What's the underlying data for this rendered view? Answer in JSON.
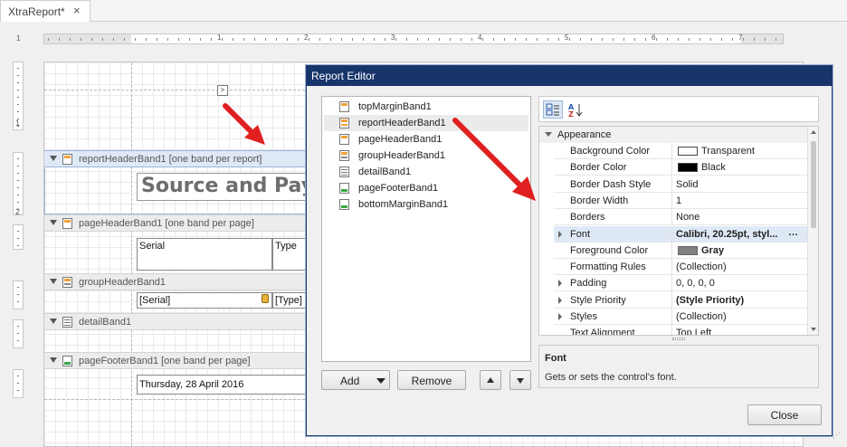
{
  "document_tab": {
    "label": "XtraReport*",
    "close": "×"
  },
  "ruler": {
    "corner_number": "1",
    "numbers": [
      "1",
      "2",
      "3",
      "4",
      "5",
      "6",
      "7"
    ]
  },
  "vruler_marks": [
    "1",
    "2"
  ],
  "designer": {
    "bands": [
      {
        "label": "reportHeaderBand1 [one band per report]",
        "selected": true
      },
      {
        "label": "pageHeaderBand1 [one band per page]"
      },
      {
        "label": "groupHeaderBand1"
      },
      {
        "label": "detailBand1"
      },
      {
        "label": "pageFooterBand1 [one band per page]"
      }
    ],
    "title_text": "Source and Paym",
    "smart_tag": ">",
    "header_cells": [
      "Serial",
      "Type"
    ],
    "group_cells": [
      "[Serial]",
      "[Type]"
    ],
    "footer_date": "Thursday, 28 April 2016"
  },
  "dialog": {
    "title": "Report Editor",
    "band_list": [
      {
        "label": "topMarginBand1",
        "icon": "top-margin-band-icon"
      },
      {
        "label": "reportHeaderBand1",
        "icon": "report-header-band-icon",
        "selected": true
      },
      {
        "label": "pageHeaderBand1",
        "icon": "page-header-band-icon"
      },
      {
        "label": "groupHeaderBand1",
        "icon": "group-header-band-icon"
      },
      {
        "label": "detailBand1",
        "icon": "detail-band-icon"
      },
      {
        "label": "pageFooterBand1",
        "icon": "page-footer-band-icon"
      },
      {
        "label": "bottomMarginBand1",
        "icon": "bottom-margin-band-icon"
      }
    ],
    "buttons": {
      "add": "Add",
      "remove": "Remove",
      "close": "Close"
    },
    "property_grid": {
      "category": "Appearance",
      "properties": [
        {
          "name": "Background Color",
          "value": "Transparent",
          "swatch": "#ffffff"
        },
        {
          "name": "Border Color",
          "value": "Black",
          "swatch": "#000000"
        },
        {
          "name": "Border Dash Style",
          "value": "Solid"
        },
        {
          "name": "Border Width",
          "value": "1"
        },
        {
          "name": "Borders",
          "value": "None"
        },
        {
          "name": "Font",
          "value": "Calibri, 20.25pt, styl...",
          "bold": true,
          "expandable": true,
          "selected": true,
          "ellipsis": "…"
        },
        {
          "name": "Foreground Color",
          "value": "Gray",
          "swatch": "#808080",
          "bold": true
        },
        {
          "name": "Formatting Rules",
          "value": "(Collection)"
        },
        {
          "name": "Padding",
          "value": "0, 0, 0, 0",
          "expandable": true
        },
        {
          "name": "Style Priority",
          "value": "(Style Priority)",
          "bold": true,
          "expandable": true
        },
        {
          "name": "Styles",
          "value": "(Collection)",
          "expandable": true
        },
        {
          "name": "Text Alignment",
          "value": "Top Left"
        }
      ]
    },
    "description": {
      "title": "Font",
      "text": "Gets or sets the control's font."
    }
  },
  "colors": {
    "dialog_title_bar": "#17346b",
    "arrow": "#e02020",
    "selection": "#dfe9f6"
  }
}
